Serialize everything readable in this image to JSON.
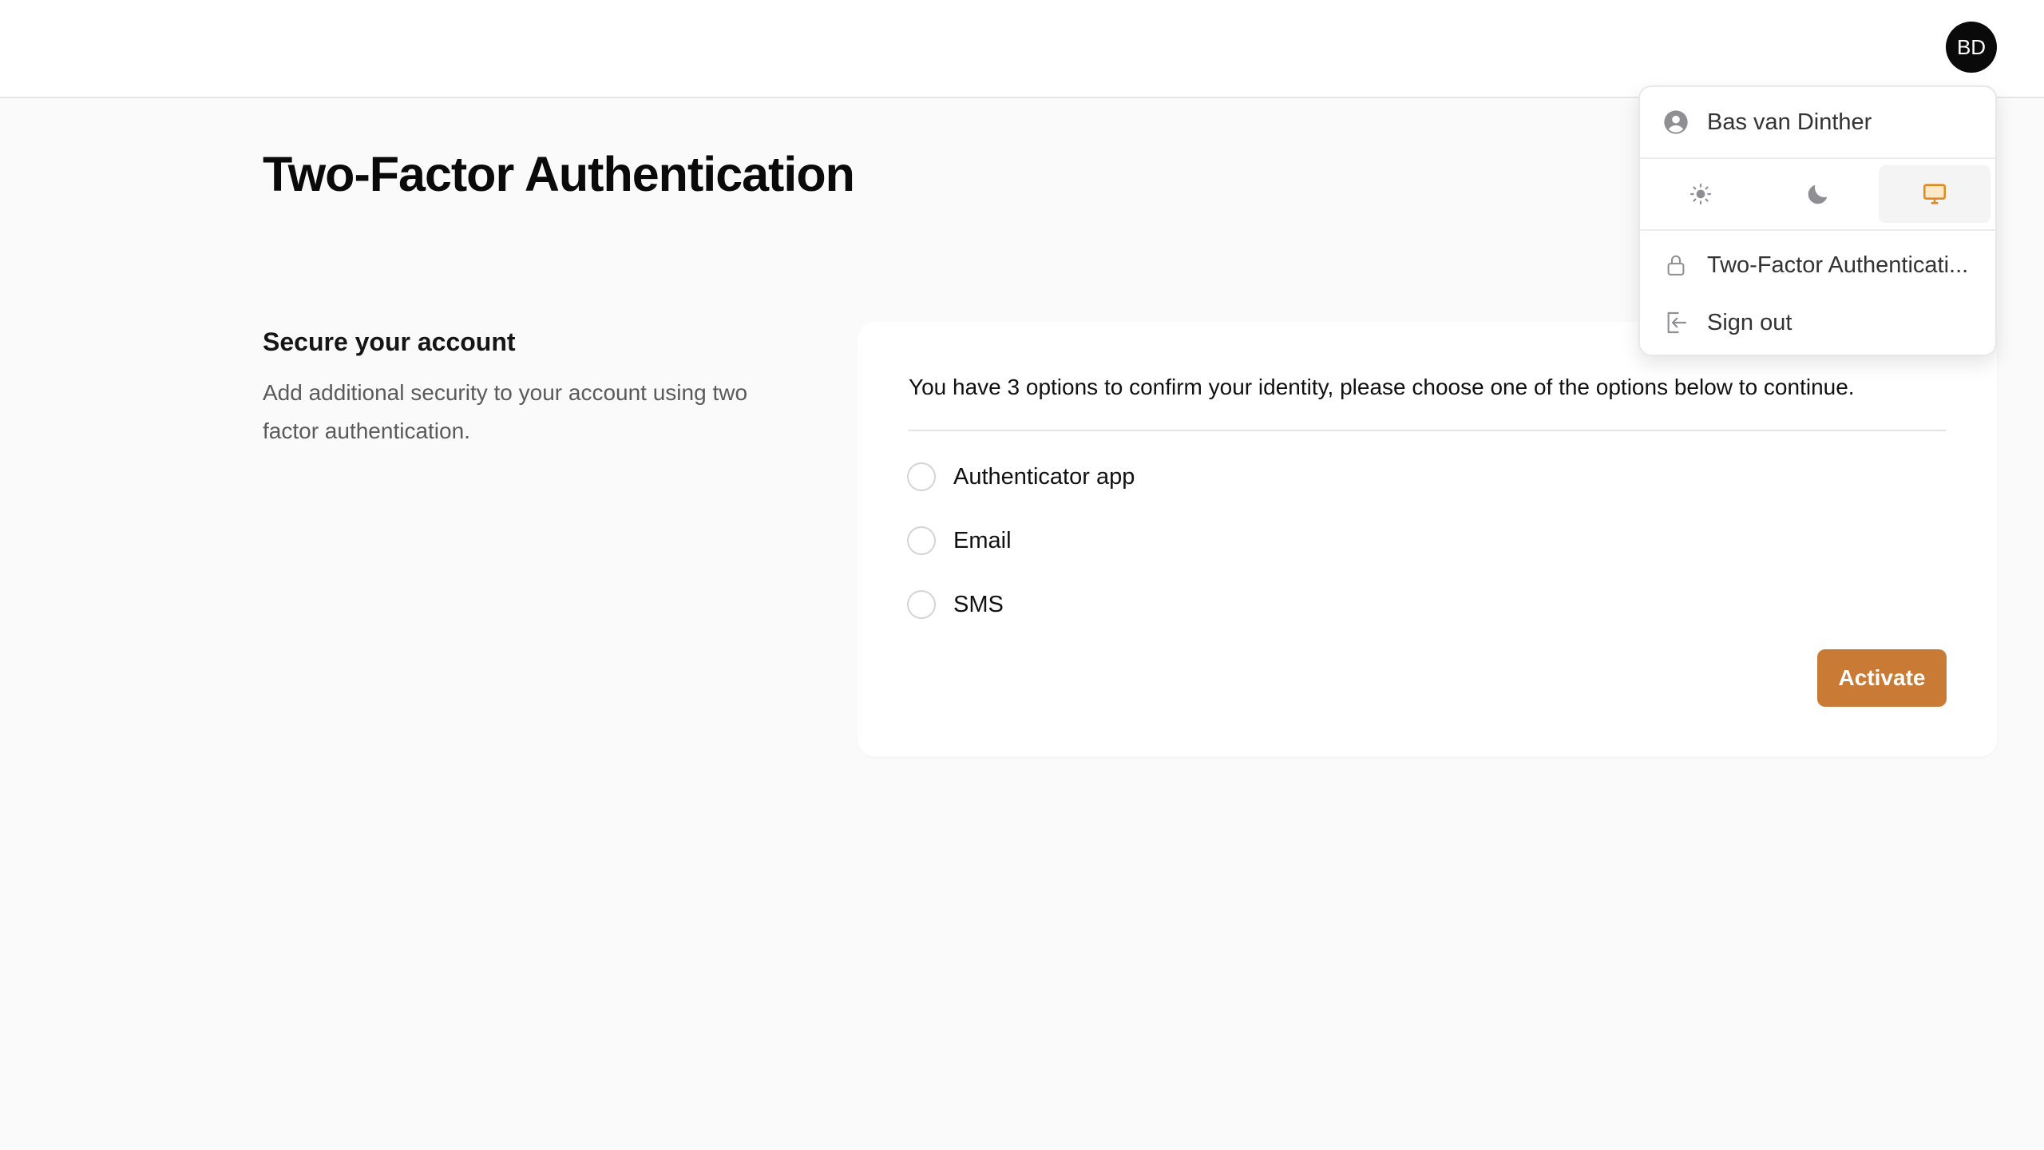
{
  "header": {
    "avatar_initials": "BD"
  },
  "main": {
    "title": "Two-Factor Authentication",
    "section_title": "Secure your account",
    "section_description": "Add additional security to your account using two factor authentication."
  },
  "card": {
    "intro": "You have 3 options to confirm your identity, please choose one of the options below to continue.",
    "options": [
      {
        "label": "Authenticator app",
        "selected": false
      },
      {
        "label": "Email",
        "selected": false
      },
      {
        "label": "SMS",
        "selected": false
      }
    ],
    "activate_label": "Activate"
  },
  "user_menu": {
    "user_name": "Bas van Dinther",
    "user_icon": "user-circle-icon",
    "themes": [
      {
        "name": "light",
        "icon": "sun-icon",
        "active": false
      },
      {
        "name": "dark",
        "icon": "moon-icon",
        "active": false
      },
      {
        "name": "system",
        "icon": "monitor-icon",
        "active": true
      }
    ],
    "items": [
      {
        "label": "Two-Factor Authenticati...",
        "icon": "lock-icon"
      },
      {
        "label": "Sign out",
        "icon": "sign-out-icon"
      }
    ]
  },
  "colors": {
    "accent": "#c97a34",
    "active_theme_icon": "#e08a1e",
    "background": "#fafafa",
    "card": "#ffffff"
  }
}
